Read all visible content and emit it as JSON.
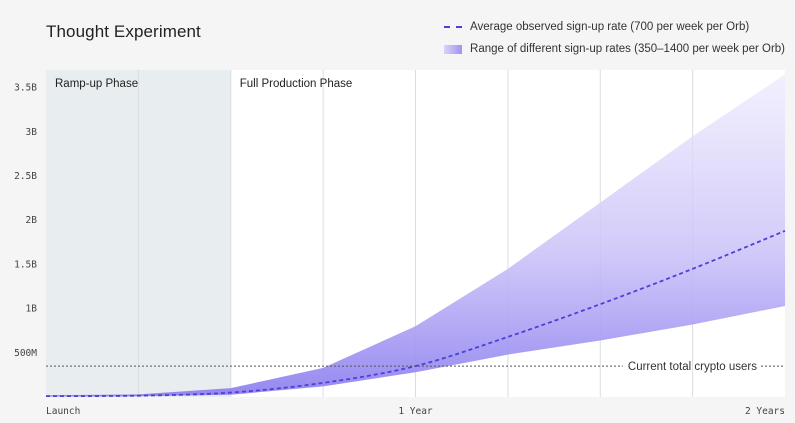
{
  "chart_data": {
    "type": "area",
    "title": "Thought Experiment",
    "xlabel": "",
    "ylabel": "",
    "x_ticks": [
      "Launch",
      "1 Year",
      "2 Years"
    ],
    "y_ticks": [
      "500M",
      "1B",
      "1.5B",
      "2B",
      "2.5B",
      "3B",
      "3.5B"
    ],
    "y_tick_values": [
      500000000,
      1000000000,
      1500000000,
      2000000000,
      2500000000,
      3000000000,
      3500000000
    ],
    "ylim": [
      0,
      3700000000
    ],
    "xlim_weeks": [
      0,
      104
    ],
    "phases": [
      {
        "label": "Ramp-up Phase",
        "start_week": 0,
        "end_week": 26
      },
      {
        "label": "Full Production Phase",
        "start_week": 26,
        "end_week": 104
      }
    ],
    "reference_line": {
      "label": "Current total crypto users",
      "value": 350000000
    },
    "series": [
      {
        "name": "Average observed sign-up rate (700 per week per Orb)",
        "style": "dashed",
        "color": "#4f3fd6",
        "x_weeks": [
          0,
          13,
          26,
          39,
          52,
          65,
          78,
          91,
          104
        ],
        "values": [
          10000000,
          15000000,
          50000000,
          160000000,
          350000000,
          680000000,
          1050000000,
          1450000000,
          1880000000
        ]
      },
      {
        "name": "Range of different sign-up rates (350–1400 per week per Orb)",
        "style": "band",
        "color": "#9f94f0",
        "x_weeks": [
          0,
          13,
          26,
          39,
          52,
          65,
          78,
          91,
          104
        ],
        "lower": [
          5000000,
          8000000,
          25000000,
          120000000,
          280000000,
          480000000,
          640000000,
          820000000,
          1030000000
        ],
        "upper": [
          20000000,
          30000000,
          100000000,
          330000000,
          800000000,
          1450000000,
          2200000000,
          2950000000,
          3650000000
        ]
      }
    ]
  }
}
